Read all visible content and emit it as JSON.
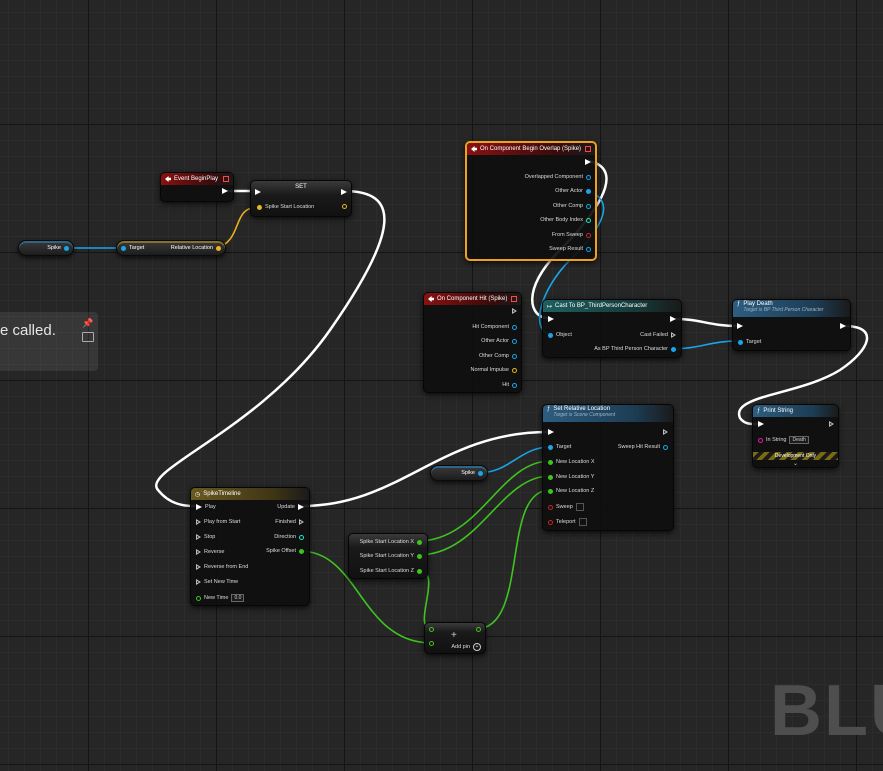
{
  "comment": {
    "text": "e called."
  },
  "watermark": "BLU",
  "nodes": {
    "event_begin_play": {
      "title": "Event BeginPlay"
    },
    "set_node": {
      "title": "SET",
      "pin": "Spike Start Location"
    },
    "spike_var_1": {
      "label": "Spike"
    },
    "get_relative_location": {
      "target": "Target",
      "output": "Relative Location"
    },
    "on_begin_overlap": {
      "title": "On Component Begin Overlap (Spike)",
      "pins": [
        "Overlapped Component",
        "Other Actor",
        "Other Comp",
        "Other Body Index",
        "From Sweep",
        "Sweep Result"
      ]
    },
    "on_hit": {
      "title": "On Component Hit (Spike)",
      "pins": [
        "Hit Component",
        "Other Actor",
        "Other Comp",
        "Normal Impulse",
        "Hit"
      ]
    },
    "cast_node": {
      "title": "Cast To BP_ThirdPersonCharacter",
      "object": "Object",
      "cast_failed": "Cast Failed",
      "as_output": "As BP Third Person Character"
    },
    "play_death": {
      "title": "Play Death",
      "subtitle": "Target is BP Third Person Character",
      "target": "Target"
    },
    "print_string": {
      "title": "Print String",
      "in_string_label": "In String",
      "in_string_value": "Death",
      "dev_only": "Development Only"
    },
    "set_relative_location": {
      "title": "Set Relative Location",
      "subtitle": "Target is Scene Component",
      "target": "Target",
      "sweep_hit": "Sweep Hit Result",
      "pins": [
        "New Location X",
        "New Location Y",
        "New Location Z",
        "Sweep",
        "Teleport"
      ]
    },
    "spike_var_2": {
      "label": "Spike"
    },
    "timeline": {
      "title": "SpikeTimeline",
      "inputs": [
        "Play",
        "Play from Start",
        "Stop",
        "Reverse",
        "Reverse from End",
        "Set New Time",
        "New Time"
      ],
      "outputs": [
        "Update",
        "Finished",
        "Direction",
        "Spike Offset"
      ],
      "new_time_value": "0.0"
    },
    "break_vector": {
      "pins": [
        "Spike Start Location X",
        "Spike Start Location Y",
        "Spike Start Location Z"
      ]
    },
    "add_node": {
      "symbol": "+",
      "add_pin": "Add pin"
    }
  },
  "colors": {
    "exec": "#ffffff",
    "object": "#1aa5e8",
    "float": "#3ec41e",
    "vector": "#e8b51a",
    "event_header": "#8a1111",
    "selected_border": "#f0a020"
  }
}
